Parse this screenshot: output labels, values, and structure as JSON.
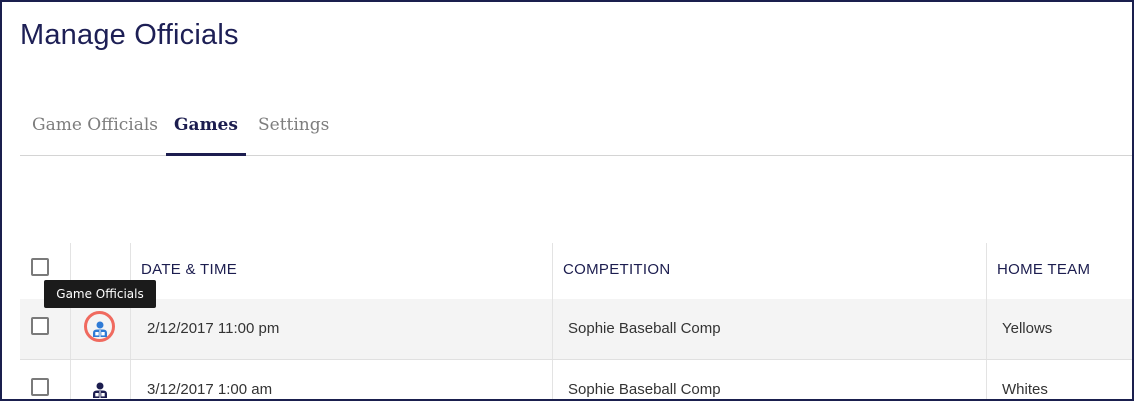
{
  "page": {
    "title": "Manage Officials"
  },
  "tabs": [
    {
      "label": "Game Officials",
      "active": false
    },
    {
      "label": "Games",
      "active": true
    },
    {
      "label": "Settings",
      "active": false
    }
  ],
  "table": {
    "columns": [
      "DATE & TIME",
      "COMPETITION",
      "HOME TEAM"
    ],
    "rows": [
      {
        "date_time": "2/12/2017 11:00 pm",
        "competition": "Sophie Baseball Comp",
        "home_team": "Yellows",
        "icon_color": "#2e7bd6",
        "highlighted": true
      },
      {
        "date_time": "3/12/2017 1:00 am",
        "competition": "Sophie Baseball Comp",
        "home_team": "Whites",
        "icon_color": "#1c1d4f",
        "highlighted": false
      }
    ]
  },
  "tooltip": {
    "text": "Game Officials"
  },
  "colors": {
    "frame_border": "#1a1f4e",
    "title_text": "#1d1f55",
    "active_tab": "#1c1d4f",
    "inactive_tab": "#7d7d7d",
    "highlight_ring": "#f06a5f",
    "icon_active": "#2e7bd6",
    "icon_default": "#1c1d4f"
  },
  "icons": {
    "referee": "referee-icon"
  }
}
